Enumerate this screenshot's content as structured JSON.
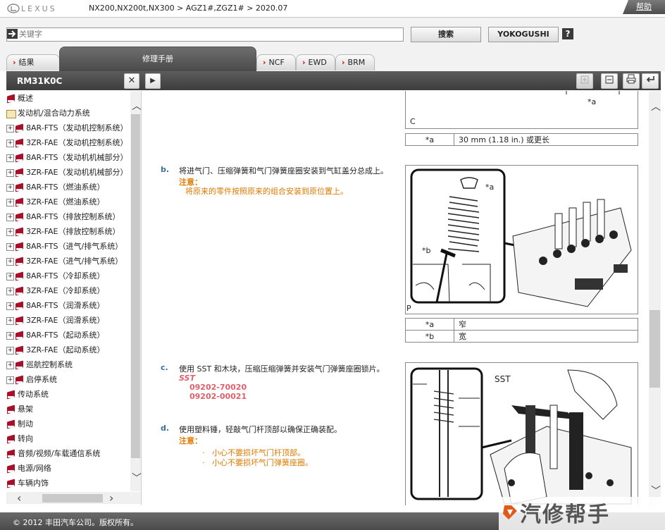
{
  "header": {
    "logo_text": "LEXUS",
    "breadcrumb": "NX200,NX200t,NX300 > AGZ1#,ZGZ1# > 2020.07",
    "help_label": "帮助"
  },
  "search": {
    "placeholder": "关键字",
    "search_button": "搜索",
    "yokogushi_button": "YOKOGUSHI",
    "help_icon": "?"
  },
  "tabs": [
    {
      "label": "结果"
    },
    {
      "label": "修理手册"
    },
    {
      "label": "NCF"
    },
    {
      "label": "EWD"
    },
    {
      "label": "BRM"
    }
  ],
  "panel": {
    "title": "RM31K0C",
    "close_glyph": "✕",
    "play_glyph": "▶"
  },
  "tree": {
    "items": [
      {
        "label": "概述",
        "icon": "book-red",
        "expand": false
      },
      {
        "label": "发动机/混合动力系统",
        "icon": "book-open",
        "expand": false
      },
      {
        "label": "8AR-FTS（发动机控制系统）",
        "icon": "book-red",
        "expand": true
      },
      {
        "label": "3ZR-FAE（发动机控制系统）",
        "icon": "book-red",
        "expand": true
      },
      {
        "label": "8AR-FTS（发动机机械部分）",
        "icon": "book-red",
        "expand": true
      },
      {
        "label": "3ZR-FAE（发动机机械部分）",
        "icon": "book-red",
        "expand": true
      },
      {
        "label": "8AR-FTS（燃油系统）",
        "icon": "book-red",
        "expand": true
      },
      {
        "label": "3ZR-FAE（燃油系统）",
        "icon": "book-red",
        "expand": true
      },
      {
        "label": "8AR-FTS（排放控制系统）",
        "icon": "book-red",
        "expand": true
      },
      {
        "label": "3ZR-FAE（排放控制系统）",
        "icon": "book-red",
        "expand": true
      },
      {
        "label": "8AR-FTS（进气/排气系统）",
        "icon": "book-red",
        "expand": true
      },
      {
        "label": "3ZR-FAE（进气/排气系统）",
        "icon": "book-red",
        "expand": true
      },
      {
        "label": "8AR-FTS（冷却系统）",
        "icon": "book-red",
        "expand": true
      },
      {
        "label": "3ZR-FAE（冷却系统）",
        "icon": "book-red",
        "expand": true
      },
      {
        "label": "8AR-FTS（润滑系统）",
        "icon": "book-red",
        "expand": true
      },
      {
        "label": "3ZR-FAE（润滑系统）",
        "icon": "book-red",
        "expand": true
      },
      {
        "label": "8AR-FTS（起动系统）",
        "icon": "book-red",
        "expand": true
      },
      {
        "label": "3ZR-FAE（起动系统）",
        "icon": "book-red",
        "expand": true
      },
      {
        "label": "巡航控制系统",
        "icon": "book-red",
        "expand": true
      },
      {
        "label": "启停系统",
        "icon": "book-red",
        "expand": true
      },
      {
        "label": "传动系统",
        "icon": "book-red",
        "expand": false
      },
      {
        "label": "悬架",
        "icon": "book-red",
        "expand": false
      },
      {
        "label": "制动",
        "icon": "book-red",
        "expand": false
      },
      {
        "label": "转向",
        "icon": "book-red",
        "expand": false
      },
      {
        "label": "音频/视频/车载通信系统",
        "icon": "book-red",
        "expand": false
      },
      {
        "label": "电源/网络",
        "icon": "book-red",
        "expand": false
      },
      {
        "label": "车辆内饰",
        "icon": "book-red",
        "expand": false
      }
    ]
  },
  "content": {
    "fig_top": {
      "label_a": "*a",
      "corner": "C",
      "legend": [
        {
          "key": "*a",
          "value": "30 mm (1.18 in.) 或更长"
        }
      ]
    },
    "step_b": {
      "letter": "b.",
      "text": "将进气门、压缩弹簧和气门弹簧座圈安装到气缸盖分总成上。",
      "note_label": "注意：",
      "note_text": "将原来的零件按照原来的组合安装到原位置上。",
      "fig_label_a": "*a",
      "fig_label_b": "*b",
      "fig_corner": "P",
      "legend": [
        {
          "key": "*a",
          "value": "窄"
        },
        {
          "key": "*b",
          "value": "宽"
        }
      ]
    },
    "step_c": {
      "letter": "c.",
      "text": "使用 SST 和木块，压缩压缩弹簧并安装气门弹簧座圈锁片。",
      "sst_label": "SST",
      "sst_codes": [
        "09202-70020",
        "09202-00021"
      ],
      "fig_label": "SST"
    },
    "step_d": {
      "letter": "d.",
      "text": "使用塑料锤，轻敲气门杆顶部以确保正确装配。",
      "note_label": "注意：",
      "notes": [
        "小心不要损坏气门杆顶部。",
        "小心不要损坏气门弹簧座圈。"
      ]
    }
  },
  "footer": {
    "copyright": "© 2012 丰田汽车公司。版权所有。"
  },
  "watermark": {
    "text": "汽修帮手"
  }
}
